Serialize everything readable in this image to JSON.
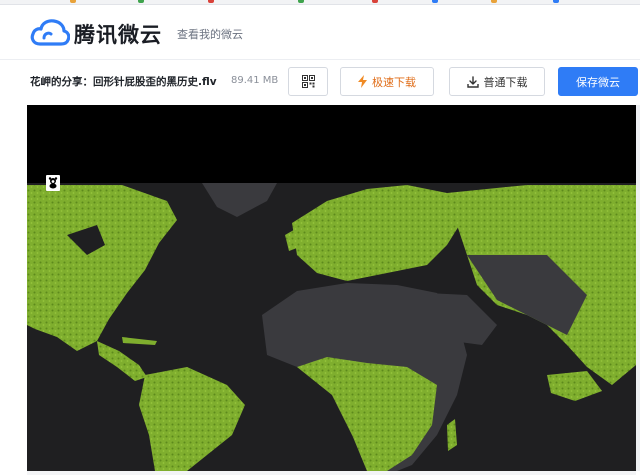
{
  "header": {
    "brand": "腾讯微云",
    "view_my_cloud": "查看我的微云",
    "logo_icon": "cloud-logo-icon",
    "brand_color": "#2f7cf6"
  },
  "share": {
    "title": "花岬的分享：回形针屁股歪的黑历史.flv",
    "size": "89.41 MB"
  },
  "actions": {
    "qr_icon": "qr-code-icon",
    "fast_download": "极速下载",
    "normal_download": "普通下载",
    "save": "保存微云"
  },
  "player": {
    "watermark_icon": "wwf-panda-icon",
    "land_color": "#7fae2e",
    "desert_color": "#3a3a3e",
    "ocean_color": "#1f1f21"
  }
}
